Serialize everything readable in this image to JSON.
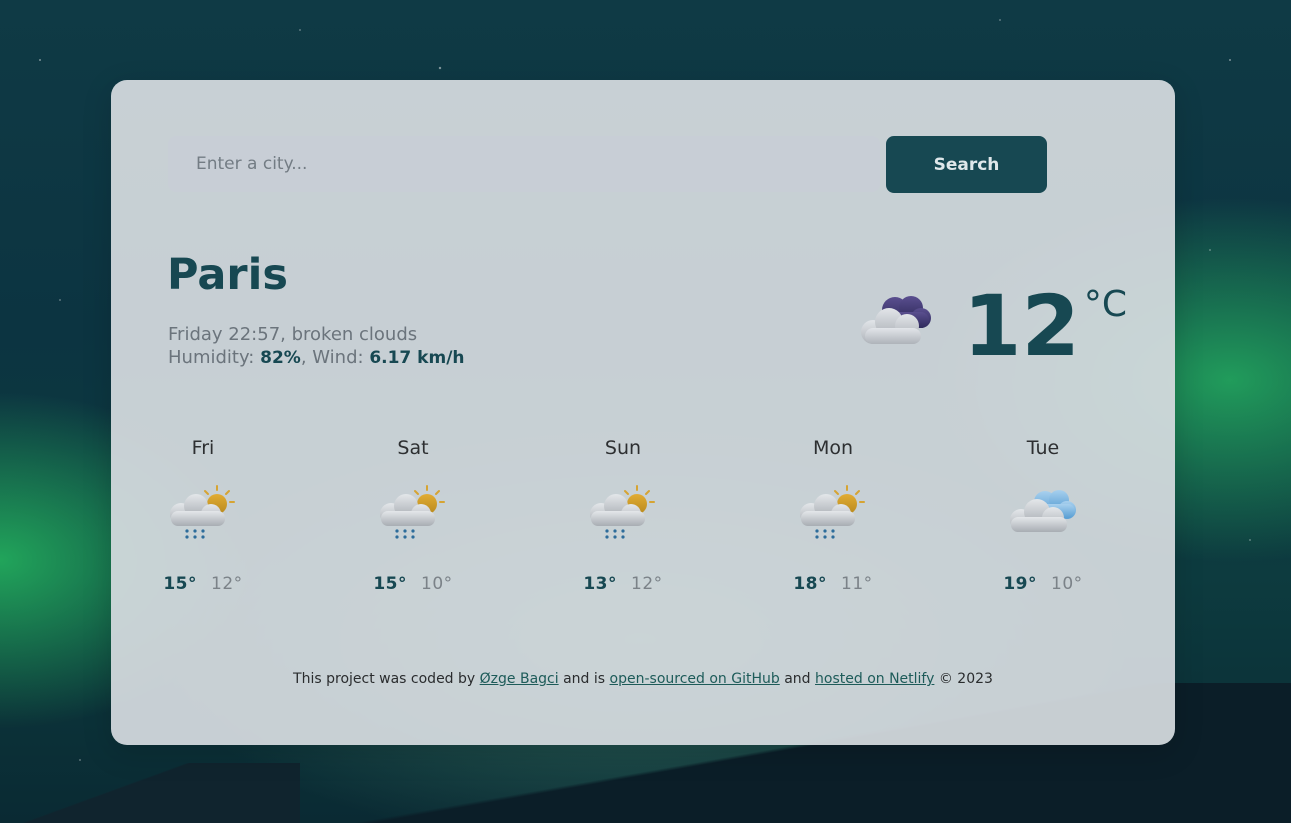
{
  "search": {
    "placeholder": "Enter a city...",
    "button_label": "Search"
  },
  "current": {
    "city": "Paris",
    "datetime_desc": "Friday 22:57, broken clouds",
    "humidity_label": "Humidity:",
    "humidity_value": "82%",
    "wind_label": "Wind:",
    "wind_value": "6.17 km/h",
    "icon": "broken-clouds-night-icon",
    "temperature": "12",
    "unit": "°C"
  },
  "forecast": [
    {
      "day": "Fri",
      "icon": "sun-cloud-rain-icon",
      "max": "15°",
      "min": "12°"
    },
    {
      "day": "Sat",
      "icon": "sun-cloud-rain-icon",
      "max": "15°",
      "min": "10°"
    },
    {
      "day": "Sun",
      "icon": "sun-cloud-rain-icon",
      "max": "13°",
      "min": "12°"
    },
    {
      "day": "Mon",
      "icon": "sun-cloud-rain-icon",
      "max": "18°",
      "min": "11°"
    },
    {
      "day": "Tue",
      "icon": "clouds-icon",
      "max": "19°",
      "min": "10°"
    }
  ],
  "footer": {
    "text1": "This project was coded by",
    "link_author": "Øzge Bagci",
    "text2": "and is",
    "link_github": "open-sourced on GitHub",
    "text3": "and",
    "link_netlify": "hosted on Netlify",
    "text4": "© 2023"
  },
  "colors": {
    "accent": "#174852",
    "card_bg": "#d6dbe0",
    "input_bg": "#c8ced6"
  }
}
